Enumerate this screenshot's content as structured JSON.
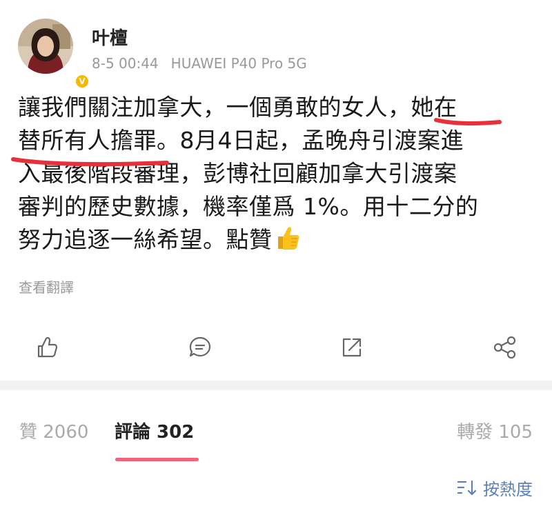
{
  "post": {
    "author": "叶檀",
    "timestamp": "8-5 00:44",
    "device": "HUAWEI P40 Pro 5G",
    "verified_icon": "verified-badge-icon",
    "content_lines": [
      "讓我們關注加拿大，一個勇敢的女人，她在",
      "替所有人擔罪。8月4日起，孟晚舟引渡案進",
      "入最後階段審理，彭博社回顧加拿大引渡案",
      "審判的歷史數據，機率僅爲 1%。用十二分的",
      "努力追逐一絲希望。點贊"
    ],
    "emoji": "thumbs-up-emoji",
    "translate_label": "查看翻譯",
    "highlight_color": "#e8303a"
  },
  "actions": {
    "like_icon": "thumbs-up-icon",
    "comment_icon": "comment-icon",
    "repost_icon": "repost-icon",
    "share_icon": "share-icon"
  },
  "tabs": {
    "likes": "贊 2060",
    "comments": "評論 302",
    "reposts": "轉發 105",
    "active_color": "#f2637a"
  },
  "sort": {
    "label": "按熱度",
    "icon": "sort-icon"
  }
}
